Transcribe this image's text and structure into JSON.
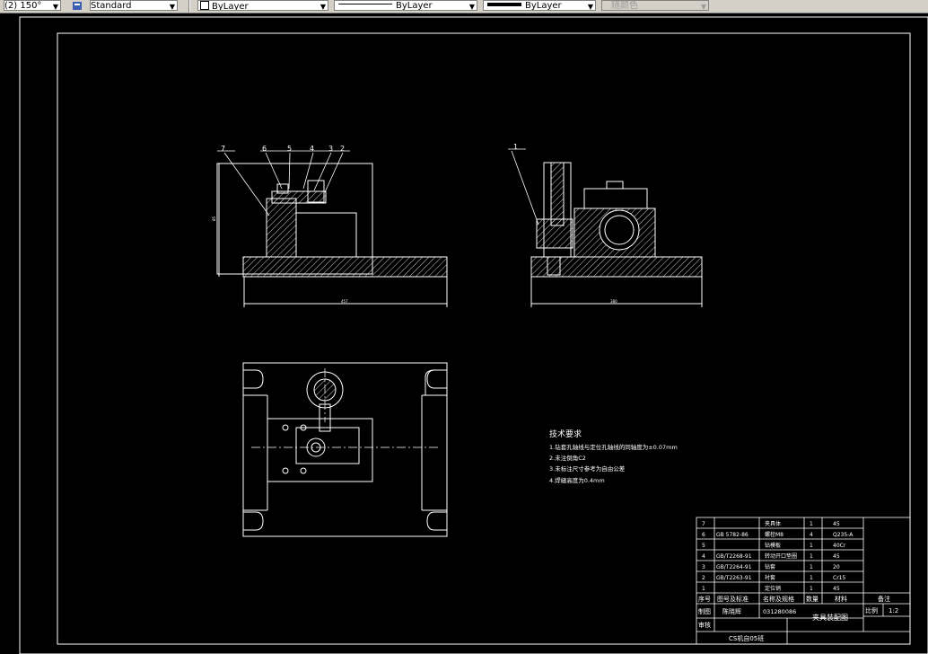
{
  "toolbar": {
    "dimstyle_value": "(2) 150°",
    "textstyle_value": "Standard",
    "layer_value": "ByLayer",
    "linetype_value": "ByLayer",
    "lineweight_value": "ByLayer",
    "color_value": "随颜色"
  },
  "colors": {
    "background": "#000000",
    "lines": "#ffffff",
    "toolbar": "#d4d0c8"
  },
  "views": {
    "front_callouts": [
      "7",
      "6",
      "5",
      "4",
      "3",
      "2"
    ],
    "side_callout": "1",
    "front_dim_value": "457",
    "side_dim_value": "380",
    "front_height_dim": "85"
  },
  "tech_requirements": {
    "title": "技术要求",
    "items": [
      "1.钻套孔轴线与定位孔轴线的同轴度为±0.07mm",
      "2.未注倒角C2",
      "3.未标注尺寸参考为自由公差",
      "4.焊缝高度为0.4mm"
    ]
  },
  "bom": {
    "rows": [
      {
        "no": "7",
        "code": "",
        "name": "夹具体",
        "qty": "1",
        "material": "45"
      },
      {
        "no": "6",
        "code": "GB 5782-86",
        "name": "螺栓M8",
        "qty": "4",
        "material": "Q235-A"
      },
      {
        "no": "5",
        "code": "",
        "name": "钻模板",
        "qty": "1",
        "material": "40Cr"
      },
      {
        "no": "4",
        "code": "GB/T2268-91",
        "name": "转动开口垫圈",
        "qty": "1",
        "material": "45"
      },
      {
        "no": "3",
        "code": "GB/T2264-91",
        "name": "钻套",
        "qty": "1",
        "material": "20"
      },
      {
        "no": "2",
        "code": "GB/T2263-91",
        "name": "衬套",
        "qty": "1",
        "material": "Cr15"
      },
      {
        "no": "1",
        "code": "",
        "name": "定位销",
        "qty": "1",
        "material": "45"
      }
    ],
    "header": {
      "no": "序号",
      "code": "图号及标准",
      "name": "名称及规格",
      "qty": "数量",
      "material": "材料",
      "remark": "备注"
    }
  },
  "title_block": {
    "drawn_label": "制图",
    "drawn_name": "陈晓辉",
    "drawing_no": "031280086",
    "drawing_title": "夹具装配图",
    "scale_label": "比例",
    "scale_value": "1:2",
    "check_label": "审核",
    "school": "CS机自05班"
  }
}
